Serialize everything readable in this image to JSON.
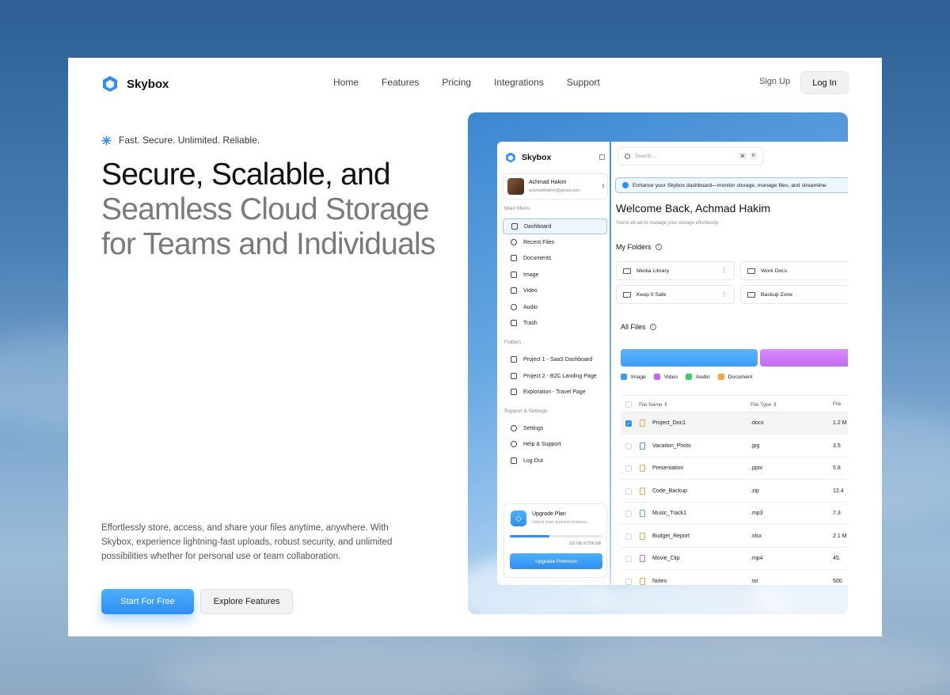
{
  "brand": {
    "name": "Skybox"
  },
  "nav": {
    "links": [
      "Home",
      "Features",
      "Pricing",
      "Integrations",
      "Support"
    ],
    "signup": "Sign Up",
    "login": "Log In"
  },
  "hero": {
    "tagline": "Fast. Secure. Unlimited. Reliable.",
    "title_dark": "Secure, Scalable, and",
    "title_light_1": "Seamless Cloud Storage",
    "title_light_2": "for Teams and Individuals",
    "description": "Effortlessly store, access, and share your files anytime, anywhere. With Skybox, experience lightning-fast uploads, robust security, and unlimited possibilities whether for personal use or team collaboration.",
    "cta_primary": "Start For Free",
    "cta_secondary": "Explore Features"
  },
  "app": {
    "brand": "Skybox",
    "user": {
      "name": "Achmad Hakim",
      "email": "achmadhakim@gmail.com"
    },
    "sections": {
      "main": "Main Menu",
      "folders": "Folders",
      "support": "Support & Settings"
    },
    "main_menu": [
      "Dashboard",
      "Recent Files",
      "Documents",
      "Image",
      "Video",
      "Audio",
      "Trash"
    ],
    "folders": [
      "Project 1 - SaaS Dashboard",
      "Project 2 - B2C Landing Page",
      "Exploration - Travel Page"
    ],
    "support_menu": [
      "Settings",
      "Help & Support",
      "Log Out"
    ],
    "upgrade": {
      "title": "Upgrade Plan",
      "subtitle": "Unlock more premium features...",
      "used_fraction": 0.43,
      "capacity": "110 GB of 256 GB",
      "button": "Upgrade Premium"
    },
    "search": {
      "placeholder": "Search....",
      "kbd1": "⌘",
      "kbd2": "K"
    },
    "banner": "Enhance your Skybox dashboard—monitor storage, manage files, and streamline",
    "welcome": "Welcome Back, Achmad Hakim",
    "welcome_sub": "You're all set to manage your storage effortlessly.",
    "my_folders_title": "My Folders",
    "my_folders": [
      "Media Library",
      "Work Docs",
      "Keep It Safe",
      "Backup Zone"
    ],
    "all_files_title": "All Files",
    "legend": [
      {
        "label": "Image",
        "color": "#3b9cf5"
      },
      {
        "label": "Video",
        "color": "#c36bf0"
      },
      {
        "label": "Audio",
        "color": "#43c96b"
      },
      {
        "label": "Document",
        "color": "#f5a742"
      }
    ],
    "table": {
      "headers": [
        "File Name",
        "File Type",
        "File"
      ],
      "rows": [
        {
          "name": "Project_Doc1",
          "type": ".docx",
          "size": "1.2 M",
          "kind": "doc",
          "selected": true
        },
        {
          "name": "Vacation_Photo",
          "type": ".jpg",
          "size": "3.5",
          "kind": "image",
          "selected": false
        },
        {
          "name": "Presentation",
          "type": ".pptx",
          "size": "5.8",
          "kind": "doc",
          "selected": false
        },
        {
          "name": "Code_Backup",
          "type": ".zip",
          "size": "12.4",
          "kind": "doc",
          "selected": false
        },
        {
          "name": "Music_Track1",
          "type": ".mp3",
          "size": "7.3",
          "kind": "audio",
          "selected": false
        },
        {
          "name": "Budget_Report",
          "type": ".xlsx",
          "size": "2.1 M",
          "kind": "doc",
          "selected": false
        },
        {
          "name": "Movie_Clip",
          "type": ".mp4",
          "size": "45.",
          "kind": "video",
          "selected": false
        },
        {
          "name": "Notes",
          "type": ".txt",
          "size": "500",
          "kind": "doc",
          "selected": false
        }
      ]
    }
  }
}
